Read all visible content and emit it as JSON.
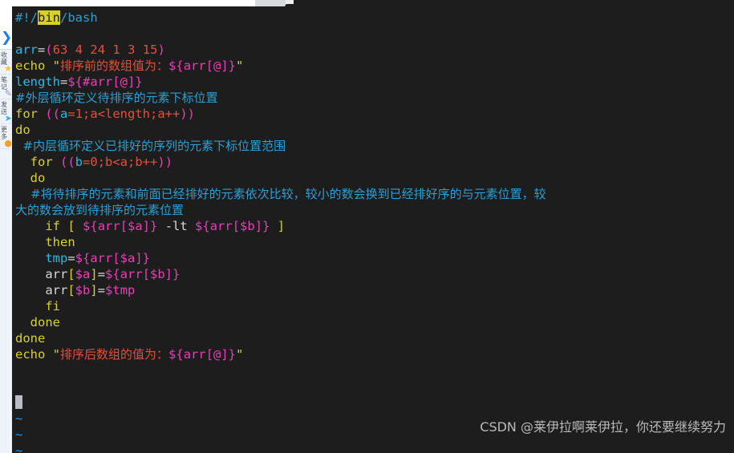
{
  "window": {
    "app": "vim",
    "background_color": "#1d1d1d"
  },
  "browser_sidebar": {
    "expand_icon": "chevron-right-icon",
    "expand_glyph": "❯",
    "items": [
      {
        "label": "收藏",
        "icon": "star-icon",
        "glyph": "★"
      },
      {
        "label": "笔记",
        "icon": "pencil-icon",
        "glyph": "✎"
      },
      {
        "label": "发送",
        "icon": "plane-icon",
        "glyph": "➤"
      },
      {
        "label": "更多",
        "icon": "dot-icon",
        "glyph": "●"
      }
    ]
  },
  "editor": {
    "search_highlight": "bin",
    "cursor": "block-cursor",
    "empty_marker": "~",
    "empty_marker_count": 3,
    "lines": [
      {
        "n": 1,
        "tokens": [
          {
            "t": "#!/",
            "c": "c-comment"
          },
          {
            "t": "bin",
            "c": "c-hl"
          },
          {
            "t": "/bash",
            "c": "c-comment"
          }
        ]
      },
      {
        "n": 2,
        "tokens": []
      },
      {
        "n": 3,
        "tokens": [
          {
            "t": "arr",
            "c": "c-var"
          },
          {
            "t": "=",
            "c": "c-plain"
          },
          {
            "t": "(",
            "c": "c-paren"
          },
          {
            "t": "63",
            "c": "c-num"
          },
          {
            "t": " ",
            "c": "c-plain"
          },
          {
            "t": "4",
            "c": "c-num"
          },
          {
            "t": " ",
            "c": "c-plain"
          },
          {
            "t": "24",
            "c": "c-num"
          },
          {
            "t": " ",
            "c": "c-plain"
          },
          {
            "t": "1",
            "c": "c-num"
          },
          {
            "t": " ",
            "c": "c-plain"
          },
          {
            "t": "3",
            "c": "c-num"
          },
          {
            "t": " ",
            "c": "c-plain"
          },
          {
            "t": "15",
            "c": "c-num"
          },
          {
            "t": ")",
            "c": "c-paren"
          }
        ]
      },
      {
        "n": 4,
        "tokens": [
          {
            "t": "echo",
            "c": "c-kw"
          },
          {
            "t": " ",
            "c": "c-plain"
          },
          {
            "t": "\"",
            "c": "c-quote"
          },
          {
            "t": "排序前的数组值为：",
            "c": "c-str cn"
          },
          {
            "t": "${arr[@]}",
            "c": "c-paren"
          },
          {
            "t": "\"",
            "c": "c-quote"
          }
        ]
      },
      {
        "n": 5,
        "tokens": [
          {
            "t": "length",
            "c": "c-var"
          },
          {
            "t": "=",
            "c": "c-plain"
          },
          {
            "t": "${#arr[@]}",
            "c": "c-paren"
          }
        ]
      },
      {
        "n": 6,
        "tokens": [
          {
            "t": "#外层循环定义待排序的元素下标位置",
            "c": "c-comment cn"
          }
        ]
      },
      {
        "n": 7,
        "tokens": [
          {
            "t": "for",
            "c": "c-kw"
          },
          {
            "t": " ",
            "c": "c-plain"
          },
          {
            "t": "((",
            "c": "c-paren"
          },
          {
            "t": "a",
            "c": "c-var"
          },
          {
            "t": "=1;a<length;a++",
            "c": "c-expr"
          },
          {
            "t": "))",
            "c": "c-paren"
          }
        ]
      },
      {
        "n": 8,
        "tokens": [
          {
            "t": "do",
            "c": "c-kw"
          }
        ]
      },
      {
        "n": 9,
        "tokens": [
          {
            "t": "  #内层循环定义已排好的序列的元素下标位置范围",
            "c": "c-comment cn"
          }
        ]
      },
      {
        "n": 10,
        "tokens": [
          {
            "t": "  ",
            "c": "c-plain"
          },
          {
            "t": "for",
            "c": "c-kw"
          },
          {
            "t": " ",
            "c": "c-plain"
          },
          {
            "t": "((",
            "c": "c-paren"
          },
          {
            "t": "b",
            "c": "c-var"
          },
          {
            "t": "=0;b<a;b++",
            "c": "c-expr"
          },
          {
            "t": "))",
            "c": "c-paren"
          }
        ]
      },
      {
        "n": 11,
        "tokens": [
          {
            "t": "  ",
            "c": "c-plain"
          },
          {
            "t": "do",
            "c": "c-kw"
          }
        ]
      },
      {
        "n": 12,
        "tokens": [
          {
            "t": "    #将待排序的元素和前面已经排好的元素依次比较，较小的数会换到已经排好序的与元素位置，较",
            "c": "c-comment cn"
          }
        ]
      },
      {
        "n": 13,
        "tokens": [
          {
            "t": "大的数会放到待排序的元素位置",
            "c": "c-comment cn"
          }
        ]
      },
      {
        "n": 14,
        "tokens": [
          {
            "t": "    ",
            "c": "c-plain"
          },
          {
            "t": "if",
            "c": "c-kw"
          },
          {
            "t": " ",
            "c": "c-plain"
          },
          {
            "t": "[",
            "c": "c-brkt"
          },
          {
            "t": " ",
            "c": "c-plain"
          },
          {
            "t": "${arr[$a]}",
            "c": "c-paren"
          },
          {
            "t": " ",
            "c": "c-plain"
          },
          {
            "t": "-lt",
            "c": "c-plain"
          },
          {
            "t": " ",
            "c": "c-plain"
          },
          {
            "t": "${arr[$b]}",
            "c": "c-paren"
          },
          {
            "t": " ",
            "c": "c-plain"
          },
          {
            "t": "]",
            "c": "c-brkt"
          }
        ]
      },
      {
        "n": 15,
        "tokens": [
          {
            "t": "    ",
            "c": "c-plain"
          },
          {
            "t": "then",
            "c": "c-kw"
          }
        ]
      },
      {
        "n": 16,
        "tokens": [
          {
            "t": "    ",
            "c": "c-plain"
          },
          {
            "t": "tmp",
            "c": "c-var"
          },
          {
            "t": "=",
            "c": "c-plain"
          },
          {
            "t": "${arr[$a]}",
            "c": "c-paren"
          }
        ]
      },
      {
        "n": 17,
        "tokens": [
          {
            "t": "    ",
            "c": "c-plain"
          },
          {
            "t": "arr",
            "c": "c-plain"
          },
          {
            "t": "[",
            "c": "c-brkt"
          },
          {
            "t": "$a",
            "c": "c-paren"
          },
          {
            "t": "]",
            "c": "c-brkt"
          },
          {
            "t": "=",
            "c": "c-plain"
          },
          {
            "t": "${arr[$b]}",
            "c": "c-paren"
          }
        ]
      },
      {
        "n": 18,
        "tokens": [
          {
            "t": "    ",
            "c": "c-plain"
          },
          {
            "t": "arr",
            "c": "c-plain"
          },
          {
            "t": "[",
            "c": "c-brkt"
          },
          {
            "t": "$b",
            "c": "c-paren"
          },
          {
            "t": "]",
            "c": "c-brkt"
          },
          {
            "t": "=",
            "c": "c-plain"
          },
          {
            "t": "$tmp",
            "c": "c-paren"
          }
        ]
      },
      {
        "n": 19,
        "tokens": [
          {
            "t": "    ",
            "c": "c-plain"
          },
          {
            "t": "fi",
            "c": "c-kw"
          }
        ]
      },
      {
        "n": 20,
        "tokens": [
          {
            "t": "  ",
            "c": "c-plain"
          },
          {
            "t": "done",
            "c": "c-kw"
          }
        ]
      },
      {
        "n": 21,
        "tokens": [
          {
            "t": "done",
            "c": "c-kw"
          }
        ]
      },
      {
        "n": 22,
        "tokens": [
          {
            "t": "echo",
            "c": "c-kw"
          },
          {
            "t": " ",
            "c": "c-plain"
          },
          {
            "t": "\"",
            "c": "c-quote"
          },
          {
            "t": "排序后数组的值为：",
            "c": "c-str cn"
          },
          {
            "t": "${arr[@]}",
            "c": "c-paren"
          },
          {
            "t": "\"",
            "c": "c-quote"
          }
        ]
      },
      {
        "n": 23,
        "tokens": []
      },
      {
        "n": 24,
        "tokens": []
      }
    ]
  },
  "watermark": {
    "text": "CSDN @莱伊拉啊莱伊拉，你还要继续努力"
  }
}
